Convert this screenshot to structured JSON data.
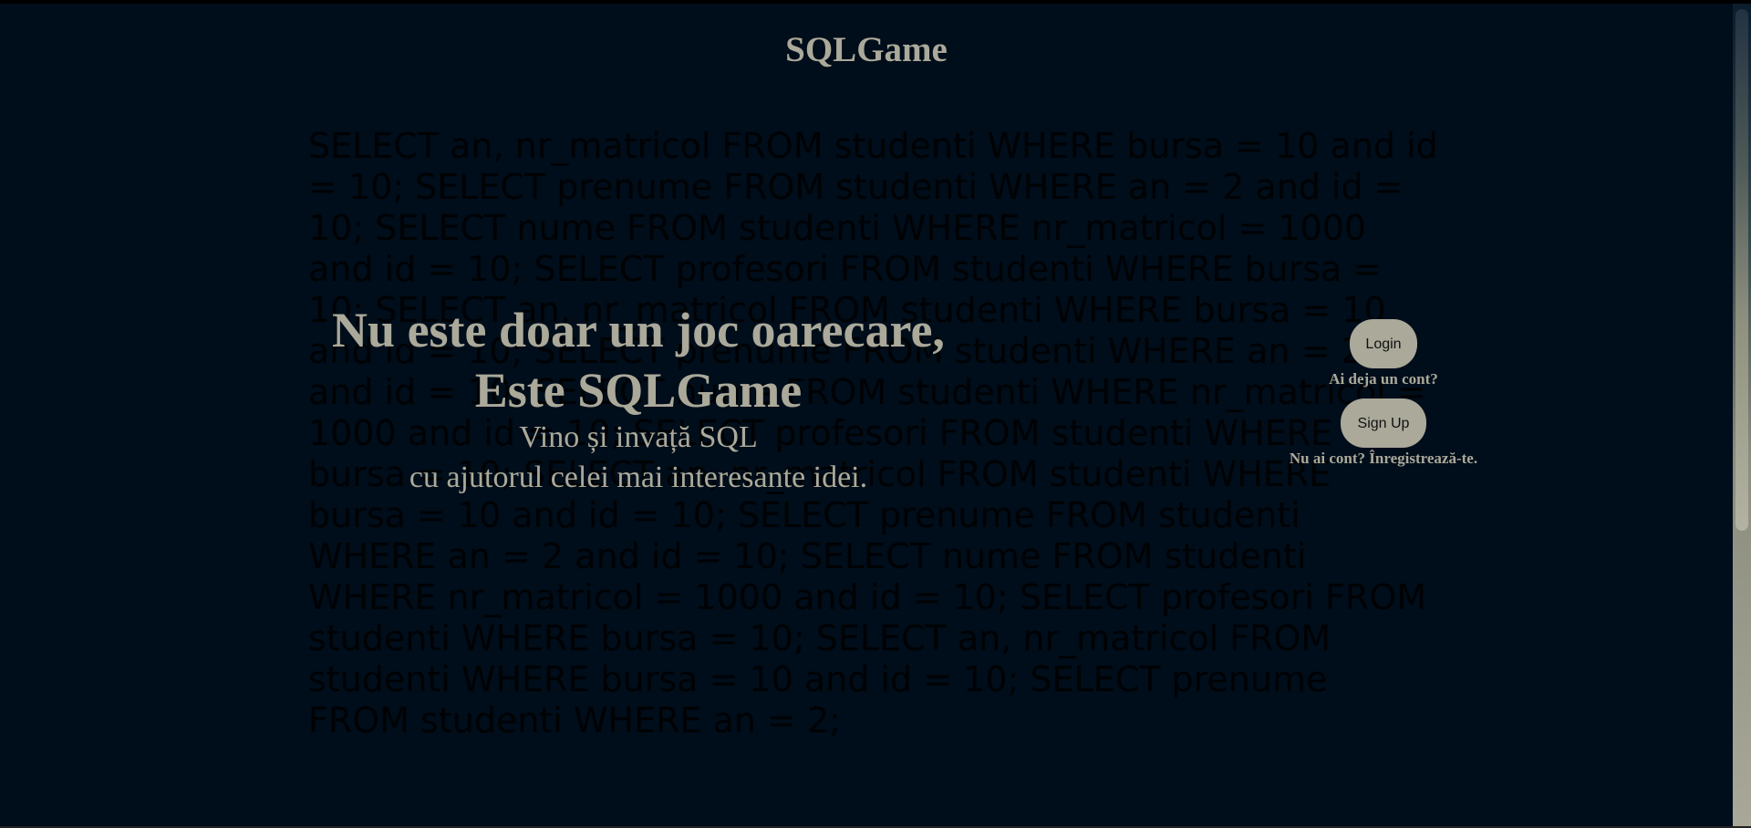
{
  "site": {
    "title": "SQLGame"
  },
  "background_sql": "SELECT an, nr_matricol FROM studenti WHERE bursa = 10 and id = 10; SELECT prenume FROM studenti WHERE an = 2 and id = 10; SELECT nume FROM studenti WHERE nr_matricol = 1000 and id = 10; SELECT profesori FROM studenti WHERE bursa = 10; SELECT an, nr_matricol FROM studenti WHERE bursa = 10 and id = 10; SELECT prenume FROM studenti WHERE an = 2 and id = 10; SELECT nume FROM studenti WHERE nr_matricol = 1000 and id = 10; SELECT profesori FROM studenti WHERE bursa = 10; SELECT an, nr_matricol FROM studenti WHERE bursa = 10 and id = 10; SELECT prenume FROM studenti WHERE an = 2 and id = 10; SELECT nume FROM studenti WHERE nr_matricol = 1000 and id = 10; SELECT profesori FROM studenti WHERE bursa = 10; SELECT an, nr_matricol FROM studenti WHERE bursa = 10 and id = 10; SELECT prenume FROM studenti WHERE an = 2;",
  "hero": {
    "line1": "Nu este doar un joc oarecare,",
    "line2": "Este SQLGame",
    "sub1": "Vino și invață SQL",
    "sub2": "cu ajutorul celei mai interesante idei."
  },
  "auth": {
    "login_label": "Login",
    "login_hint": "Ai deja un cont?",
    "signup_label": "Sign Up",
    "signup_hint": "Nu ai cont? Înregistrează-te."
  },
  "colors": {
    "background": "#000d1a",
    "accent": "#aaa99a"
  }
}
